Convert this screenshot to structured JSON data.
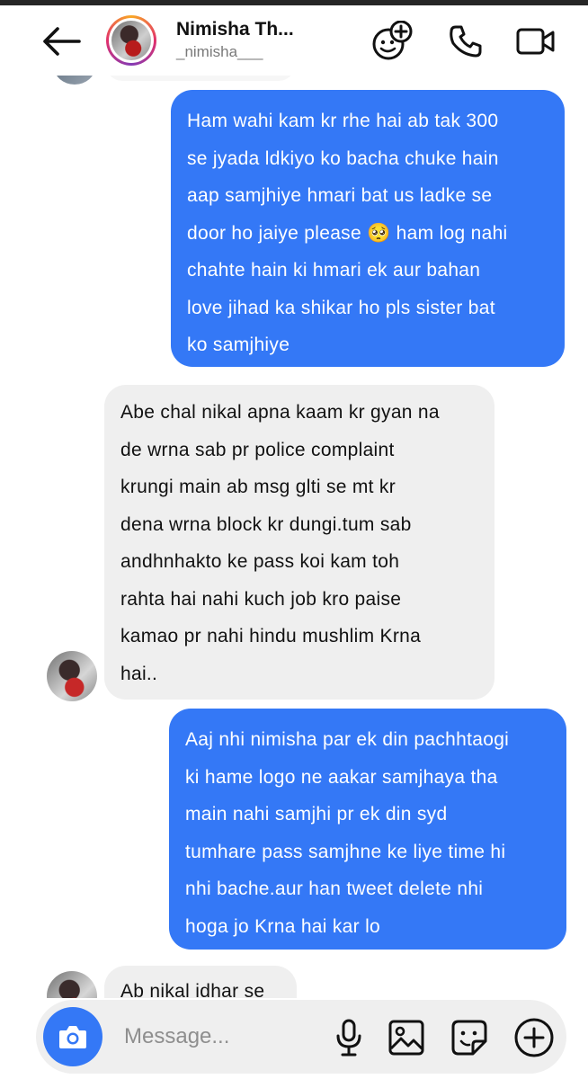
{
  "header": {
    "contact_name": "Nimisha Th...",
    "contact_handle": "_nimisha___",
    "icons": [
      "back-arrow-icon",
      "add-effect-icon",
      "phone-icon",
      "video-camera-icon"
    ]
  },
  "messages": [
    {
      "direction": "outgoing",
      "lines": [
        "Ham wahi kam kr rhe hai ab tak 300",
        "se jyada ldkiyo ko bacha chuke hain",
        "aap samjhiye hmari bat us ladke se",
        "door ho jaiye please 🥺 ham log nahi",
        "chahte hain ki hmari ek aur bahan",
        "love jihad ka shikar ho pls sister bat",
        "ko samjhiye"
      ]
    },
    {
      "direction": "incoming",
      "lines": [
        "Abe chal nikal apna kaam kr gyan na",
        "de wrna sab pr police complaint",
        "krungi main ab msg glti se mt kr",
        "dena wrna block kr dungi.tum sab",
        "andhnhakto ke pass koi kam toh",
        "rahta hai nahi kuch job kro paise",
        "kamao pr nahi hindu mushlim Krna",
        "hai.."
      ]
    },
    {
      "direction": "outgoing",
      "lines": [
        "Aaj nhi nimisha par ek din pachhtaogi",
        "ki hame logo ne aakar samjhaya tha",
        "main nahi samjhi pr ek din syd",
        "tumhare pass samjhne ke liye time hi",
        "nhi bache.aur han tweet delete nhi",
        "hoga jo Krna hai kar lo"
      ]
    },
    {
      "direction": "incoming",
      "lines": [
        "Ab nikal idhar se"
      ]
    }
  ],
  "composer": {
    "placeholder": "Message...",
    "icons": [
      "camera-icon",
      "microphone-icon",
      "gallery-icon",
      "sticker-icon",
      "plus-icon"
    ]
  },
  "colors": {
    "outgoing_bubble": "#3478f6",
    "incoming_bubble": "#efefef",
    "camera_button": "#3478f6"
  }
}
